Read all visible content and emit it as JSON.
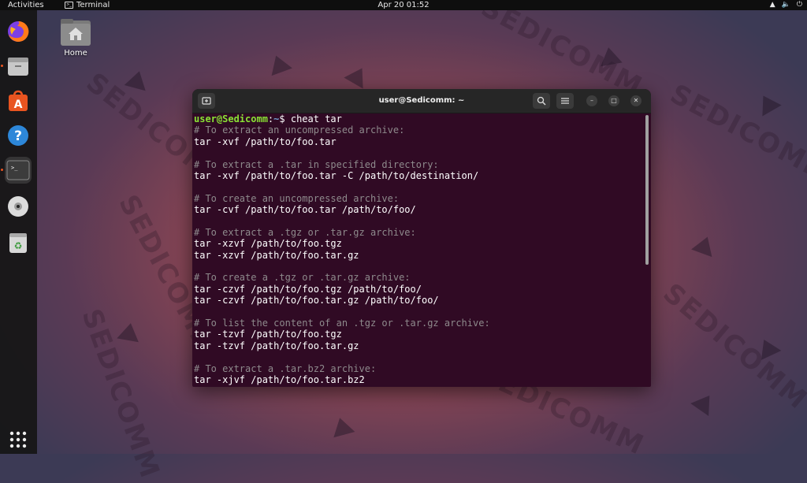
{
  "topbar": {
    "activities": "Activities",
    "app_name": "Terminal",
    "clock": "Apr 20  01:52",
    "status_icons": [
      "network-icon",
      "volume-icon",
      "power-icon"
    ]
  },
  "dock": {
    "items": [
      "firefox-icon",
      "files-icon",
      "software-icon",
      "help-icon",
      "terminal-icon",
      "dvd-icon",
      "trash-icon"
    ],
    "apps_grid": "show-applications-icon"
  },
  "desktop": {
    "home_label": "Home"
  },
  "terminal": {
    "title": "user@Sedicomm: ~",
    "prompt_user": "user@Sedicomm",
    "prompt_sep": ":",
    "prompt_path": "~",
    "prompt_symbol": "$ ",
    "command": "cheat tar",
    "lines": [
      {
        "type": "comment",
        "text": "# To extract an uncompressed archive:"
      },
      {
        "type": "cmd",
        "text": "tar -xvf /path/to/foo.tar"
      },
      {
        "type": "blank",
        "text": ""
      },
      {
        "type": "comment",
        "text": "# To extract a .tar in specified directory:"
      },
      {
        "type": "cmd",
        "text": "tar -xvf /path/to/foo.tar -C /path/to/destination/"
      },
      {
        "type": "blank",
        "text": ""
      },
      {
        "type": "comment",
        "text": "# To create an uncompressed archive:"
      },
      {
        "type": "cmd",
        "text": "tar -cvf /path/to/foo.tar /path/to/foo/"
      },
      {
        "type": "blank",
        "text": ""
      },
      {
        "type": "comment",
        "text": "# To extract a .tgz or .tar.gz archive:"
      },
      {
        "type": "cmd",
        "text": "tar -xzvf /path/to/foo.tgz"
      },
      {
        "type": "cmd",
        "text": "tar -xzvf /path/to/foo.tar.gz"
      },
      {
        "type": "blank",
        "text": ""
      },
      {
        "type": "comment",
        "text": "# To create a .tgz or .tar.gz archive:"
      },
      {
        "type": "cmd",
        "text": "tar -czvf /path/to/foo.tgz /path/to/foo/"
      },
      {
        "type": "cmd",
        "text": "tar -czvf /path/to/foo.tar.gz /path/to/foo/"
      },
      {
        "type": "blank",
        "text": ""
      },
      {
        "type": "comment",
        "text": "# To list the content of an .tgz or .tar.gz archive:"
      },
      {
        "type": "cmd",
        "text": "tar -tzvf /path/to/foo.tgz"
      },
      {
        "type": "cmd",
        "text": "tar -tzvf /path/to/foo.tar.gz"
      },
      {
        "type": "blank",
        "text": ""
      },
      {
        "type": "comment",
        "text": "# To extract a .tar.bz2 archive:"
      },
      {
        "type": "cmd",
        "text": "tar -xjvf /path/to/foo.tar.bz2"
      }
    ]
  },
  "wallpaper": {
    "watermark_text": "SEDICOMM"
  },
  "colors": {
    "terminal_bg": "#300a24",
    "prompt_user": "#8ae234",
    "prompt_path": "#729fcf",
    "accent": "#e95420"
  }
}
